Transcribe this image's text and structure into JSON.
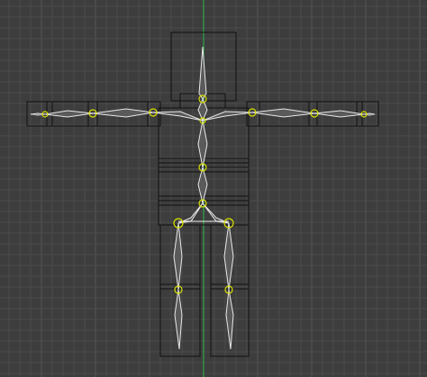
{
  "viewport": {
    "name": "3d-viewport-front-ortho",
    "colors": {
      "background": "#3d3d3d",
      "grid_minor": "#4a4a4a",
      "grid_major": "#555555",
      "z_axis": "#2fa84a",
      "mesh_wire": "#111111",
      "bone_outline": "#e8e8e8",
      "bone_fill": "#5a5a5a",
      "joint": "#d8e000"
    },
    "armature": {
      "bones": [
        "head",
        "neck",
        "spine-upper",
        "spine-lower",
        "shoulder-left",
        "upper-arm-left",
        "forearm-left",
        "hand-left",
        "shoulder-right",
        "upper-arm-right",
        "forearm-right",
        "hand-right",
        "hip-left",
        "thigh-left",
        "shin-left",
        "hip-right",
        "thigh-right",
        "shin-right"
      ]
    }
  }
}
